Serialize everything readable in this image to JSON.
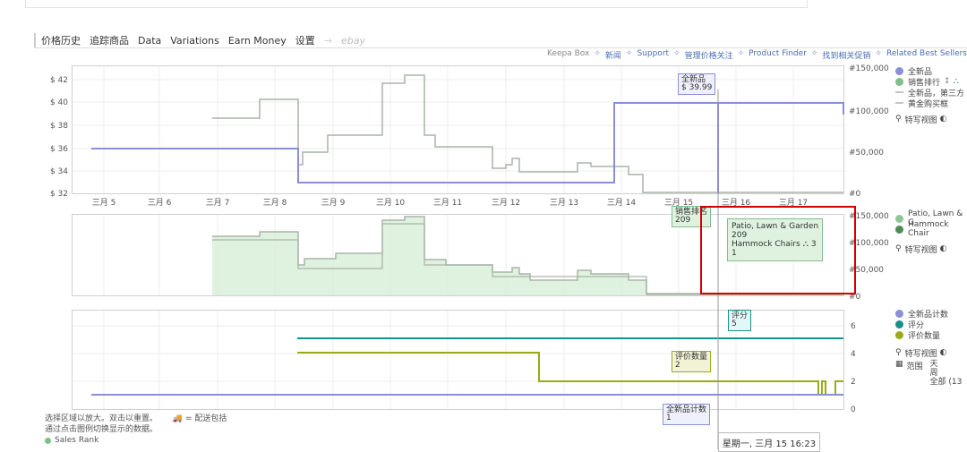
{
  "tabs": [
    "价格历史",
    "追踪商品",
    "Data",
    "Variations",
    "Earn Money",
    "设置",
    "→",
    "ebay"
  ],
  "top_links": [
    "Keepa Box",
    "新闻",
    "Support",
    "管理价格关注",
    "Product Finder",
    "找到相关促销",
    "Related Best Sellers"
  ],
  "colors": {
    "new": "#8b8fd6",
    "sales_rank": "#7fbf8a",
    "sales_rank_fill": "#cfeccf",
    "hammock": "#4f8a5a",
    "rating": "#1a8f8f",
    "review": "#9aaa1a",
    "highlight": "#d40000",
    "grid": "#ececec"
  },
  "x_axis_labels": [
    "三月 5",
    "三月 6",
    "三月 7",
    "三月 8",
    "三月 9",
    "三月 10",
    "三月 11",
    "三月 12",
    "三月 13",
    "三月 14",
    "三月 15",
    "三月 16",
    "三月 17"
  ],
  "price_chart": {
    "y_labels": [
      "$ 42",
      "$ 40",
      "$ 38",
      "$ 36",
      "$ 34",
      "$ 32"
    ],
    "right_labels": [
      "#150,000",
      "#100,000",
      "#50,000",
      "#0"
    ],
    "legend": {
      "new": "全新品",
      "rank": "销售排行",
      "third": "全新品，第三方",
      "buybox": "黄金购买框",
      "view": "特写视图"
    },
    "tooltip_title": "全新品",
    "tooltip_value": "$ 39.99"
  },
  "rank_chart": {
    "right_labels": [
      "#150,000",
      "#100,000",
      "#50,000",
      "#0"
    ],
    "legend": {
      "patio": "Patio, Lawn & G",
      "hammock": "Hammock Chair",
      "view": "特写视图"
    },
    "tooltip_title": "销售排名",
    "tooltip_value": "209",
    "popup": {
      "line1": "Patio, Lawn & Garden",
      "line2": "209",
      "line3": "Hammock Chairs",
      "line3_suffix": "3",
      "line4": "1"
    }
  },
  "rating_chart": {
    "right_labels": [
      "6",
      "4",
      "2",
      "0"
    ],
    "legend": {
      "newcount": "全新品计数",
      "rating": "评分",
      "reviews": "评价数量",
      "view": "特写视图",
      "range": "范围",
      "range_v1": "天",
      "range_v2": "周",
      "range_v3": "全部 (13"
    },
    "tip_rating_title": "评分",
    "tip_rating_value": "5",
    "tip_reviews_title": "评价数量",
    "tip_reviews_value": "2",
    "tip_count_title": "全新品计数",
    "tip_count_value": "1"
  },
  "bottom": {
    "line1": "选择区域以放大。双击以重置。",
    "shipping": "= 配送包括",
    "line2": "通过点击图例切换显示的数据。",
    "sales_rank": "Sales Rank"
  },
  "date_tooltip": "星期一, 三月 15 16:23"
}
